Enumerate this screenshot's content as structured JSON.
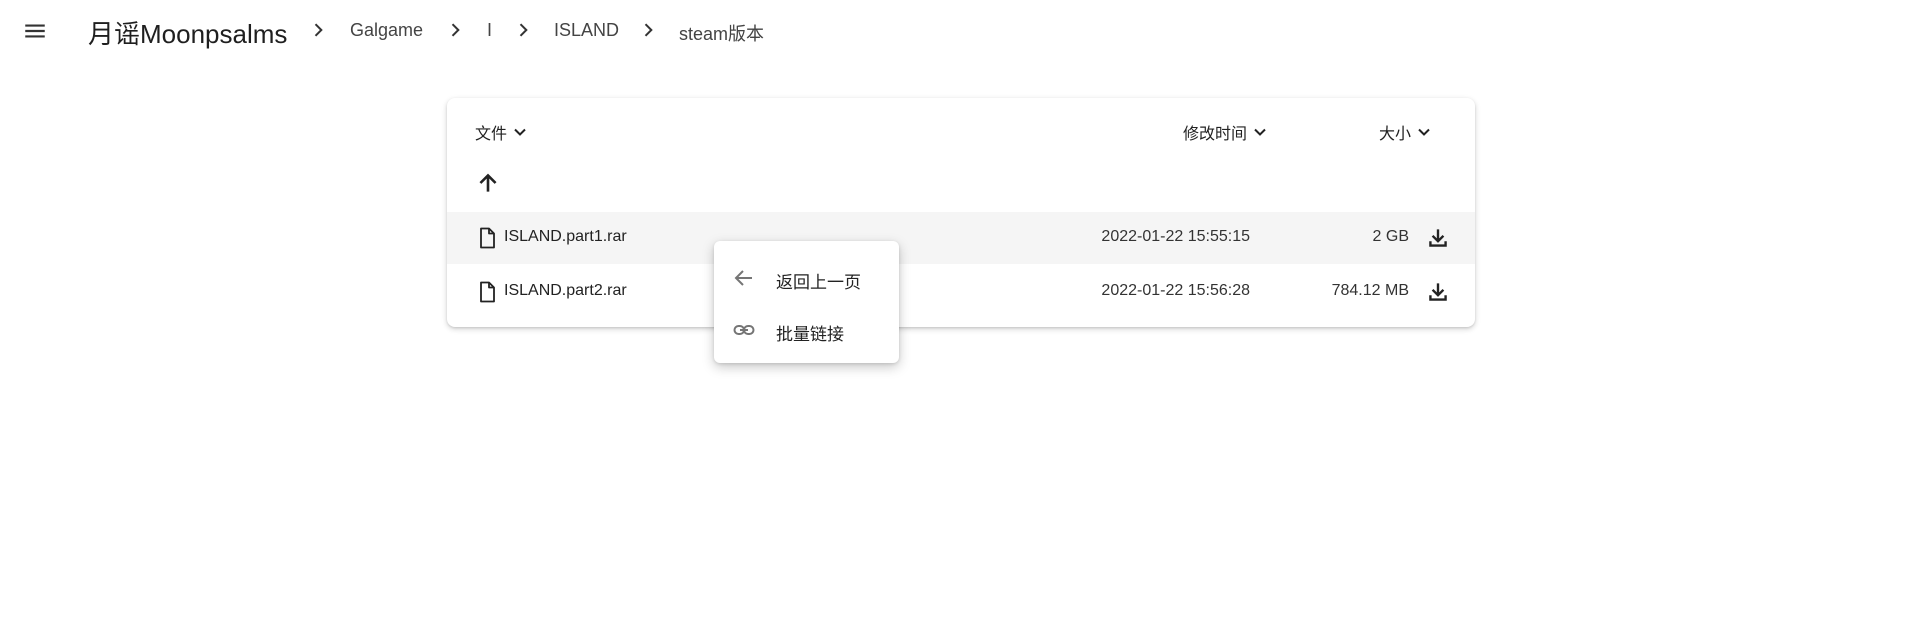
{
  "header": {
    "menu_icon": "menu-icon",
    "site_title": "月谣Moonpsalms",
    "breadcrumb": [
      {
        "label": "Galgame"
      },
      {
        "label": "I"
      },
      {
        "label": "ISLAND"
      },
      {
        "label": "steam版本"
      }
    ],
    "separator_icon": "chevron-right-icon"
  },
  "file_list": {
    "columns": {
      "name": "文件",
      "modified": "修改时间",
      "size": "大小"
    },
    "sort_icon": "chevron-down-icon",
    "up_icon": "arrow-up-icon",
    "rows": [
      {
        "icon": "file-icon",
        "name": "ISLAND.part1.rar",
        "modified": "2022-01-22 15:55:15",
        "size": "2 GB",
        "action_icon": "download-icon"
      },
      {
        "icon": "file-icon",
        "name": "ISLAND.part2.rar",
        "modified": "2022-01-22 15:56:28",
        "size": "784.12 MB",
        "action_icon": "download-icon"
      }
    ]
  },
  "context_menu": {
    "items": [
      {
        "icon": "arrow-left-icon",
        "label": "返回上一页"
      },
      {
        "icon": "link-icon",
        "label": "批量链接"
      }
    ]
  },
  "colors": {
    "row_hover": "#f5f5f5",
    "icon": "#333333",
    "menu_icon": "#757575"
  }
}
